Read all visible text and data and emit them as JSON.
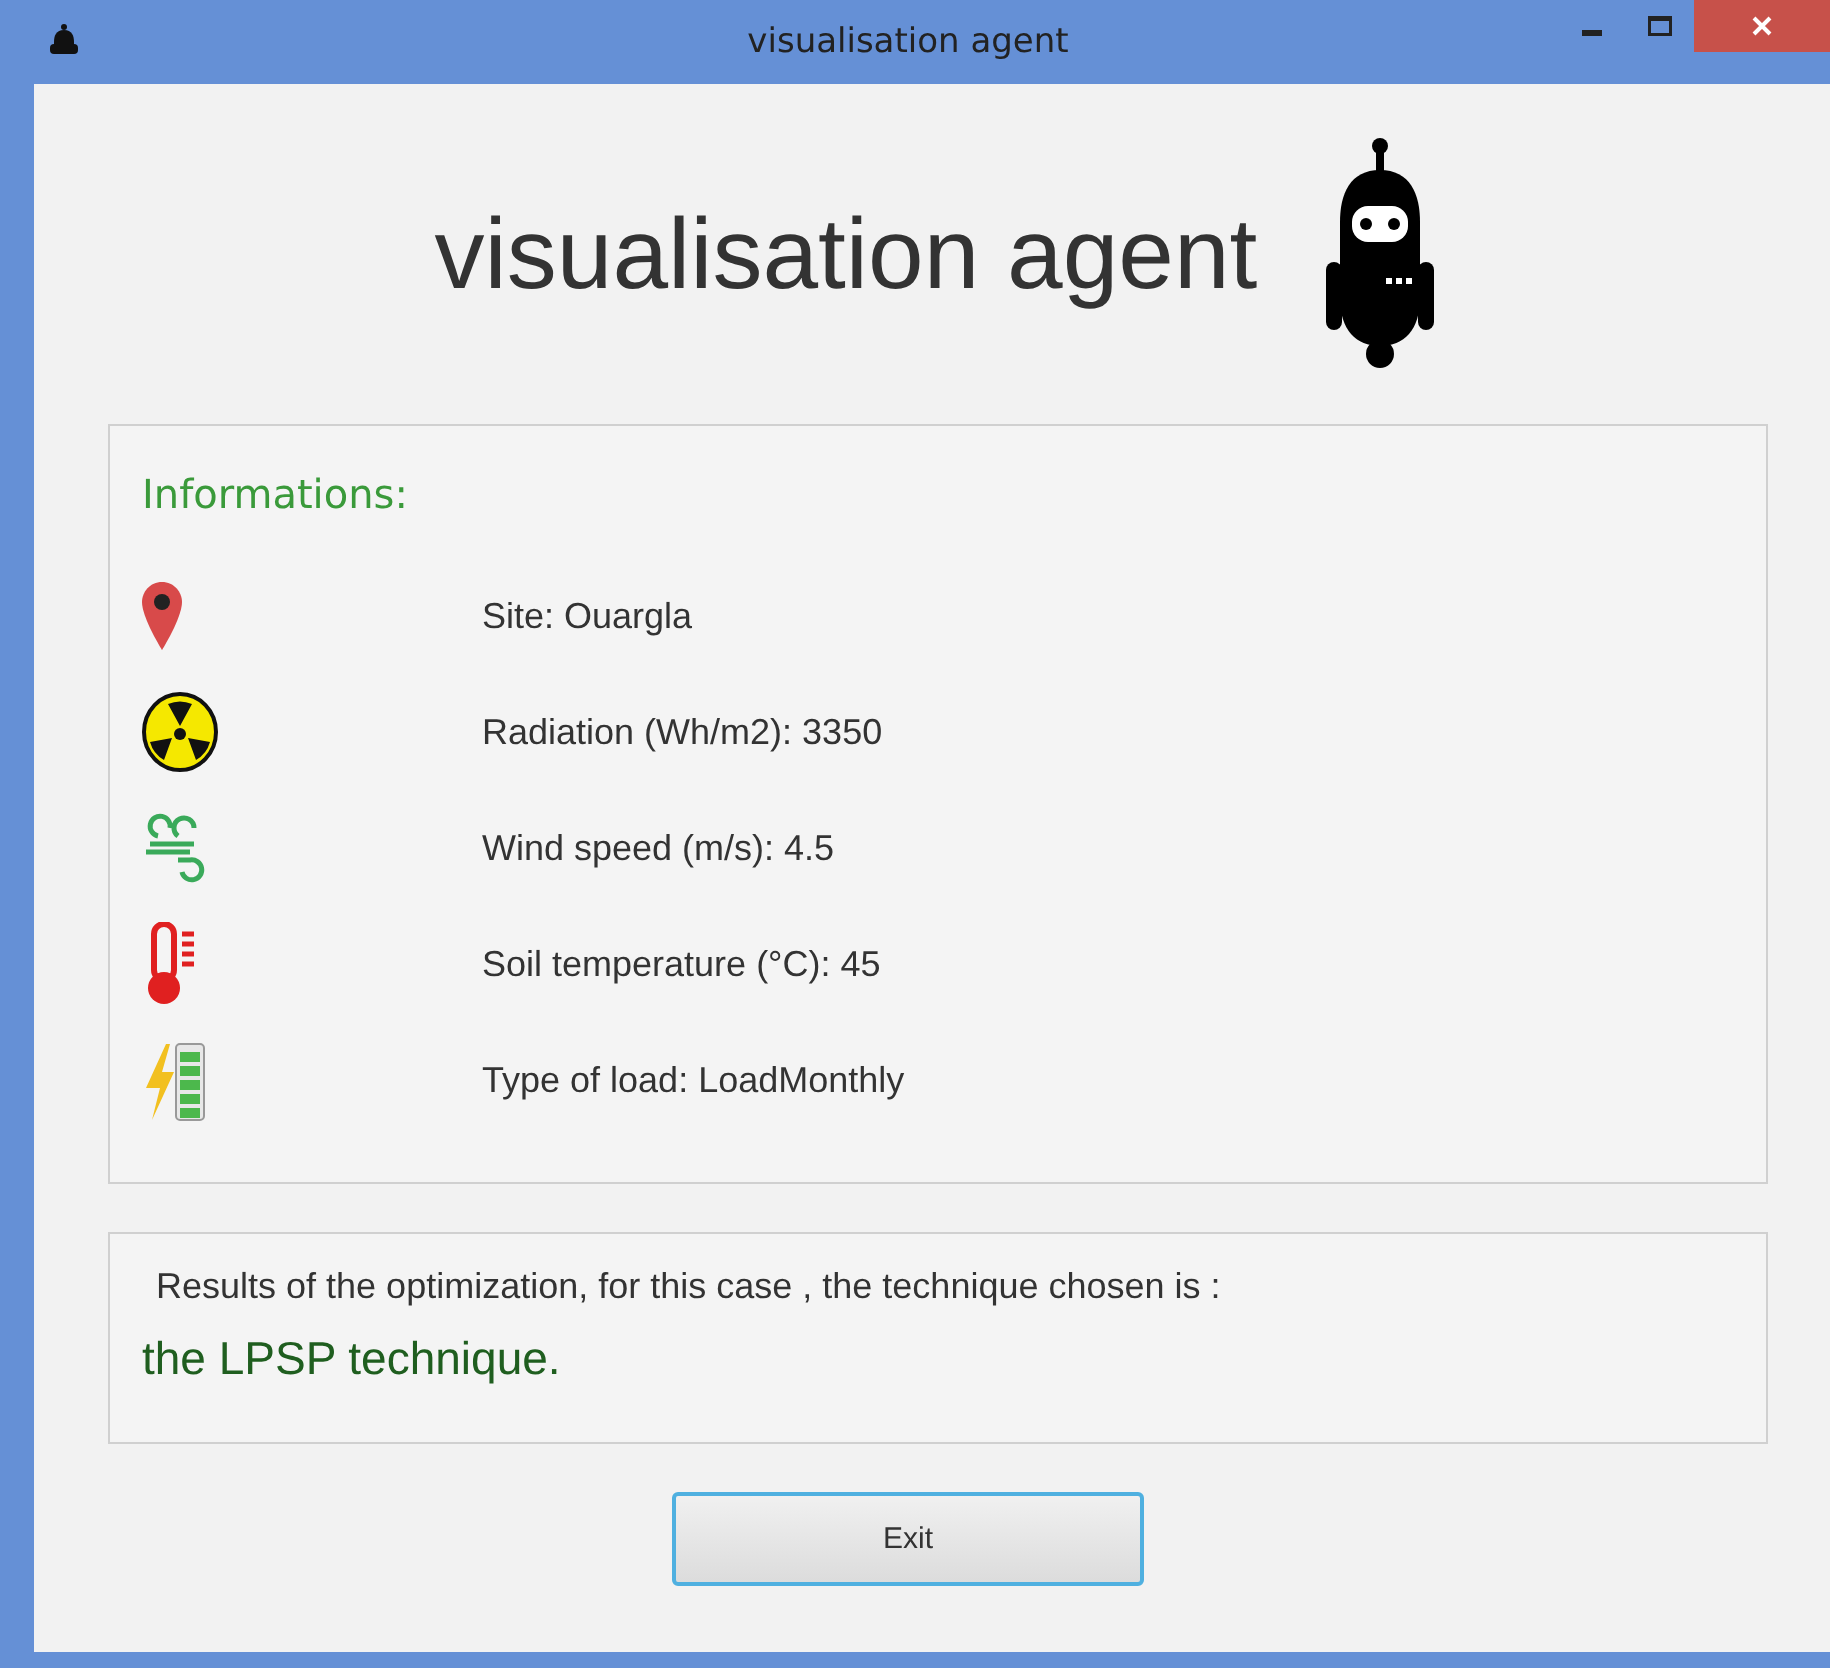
{
  "window": {
    "title": "visualisation agent"
  },
  "heading": "visualisation agent",
  "informations": {
    "title": "Informations:",
    "items": [
      {
        "kind": "location",
        "text": "Site: Ouargla"
      },
      {
        "kind": "radiation",
        "text": "Radiation (Wh/m2): 3350"
      },
      {
        "kind": "wind",
        "text": "Wind speed (m/s): 4.5"
      },
      {
        "kind": "temperature",
        "text": "Soil temperature (°C): 45"
      },
      {
        "kind": "load",
        "text": "Type of load: LoadMonthly"
      }
    ]
  },
  "results": {
    "intro": "Results of the optimization, for this case , the technique chosen is :",
    "answer": "the LPSP technique."
  },
  "buttons": [
    "Exit"
  ]
}
